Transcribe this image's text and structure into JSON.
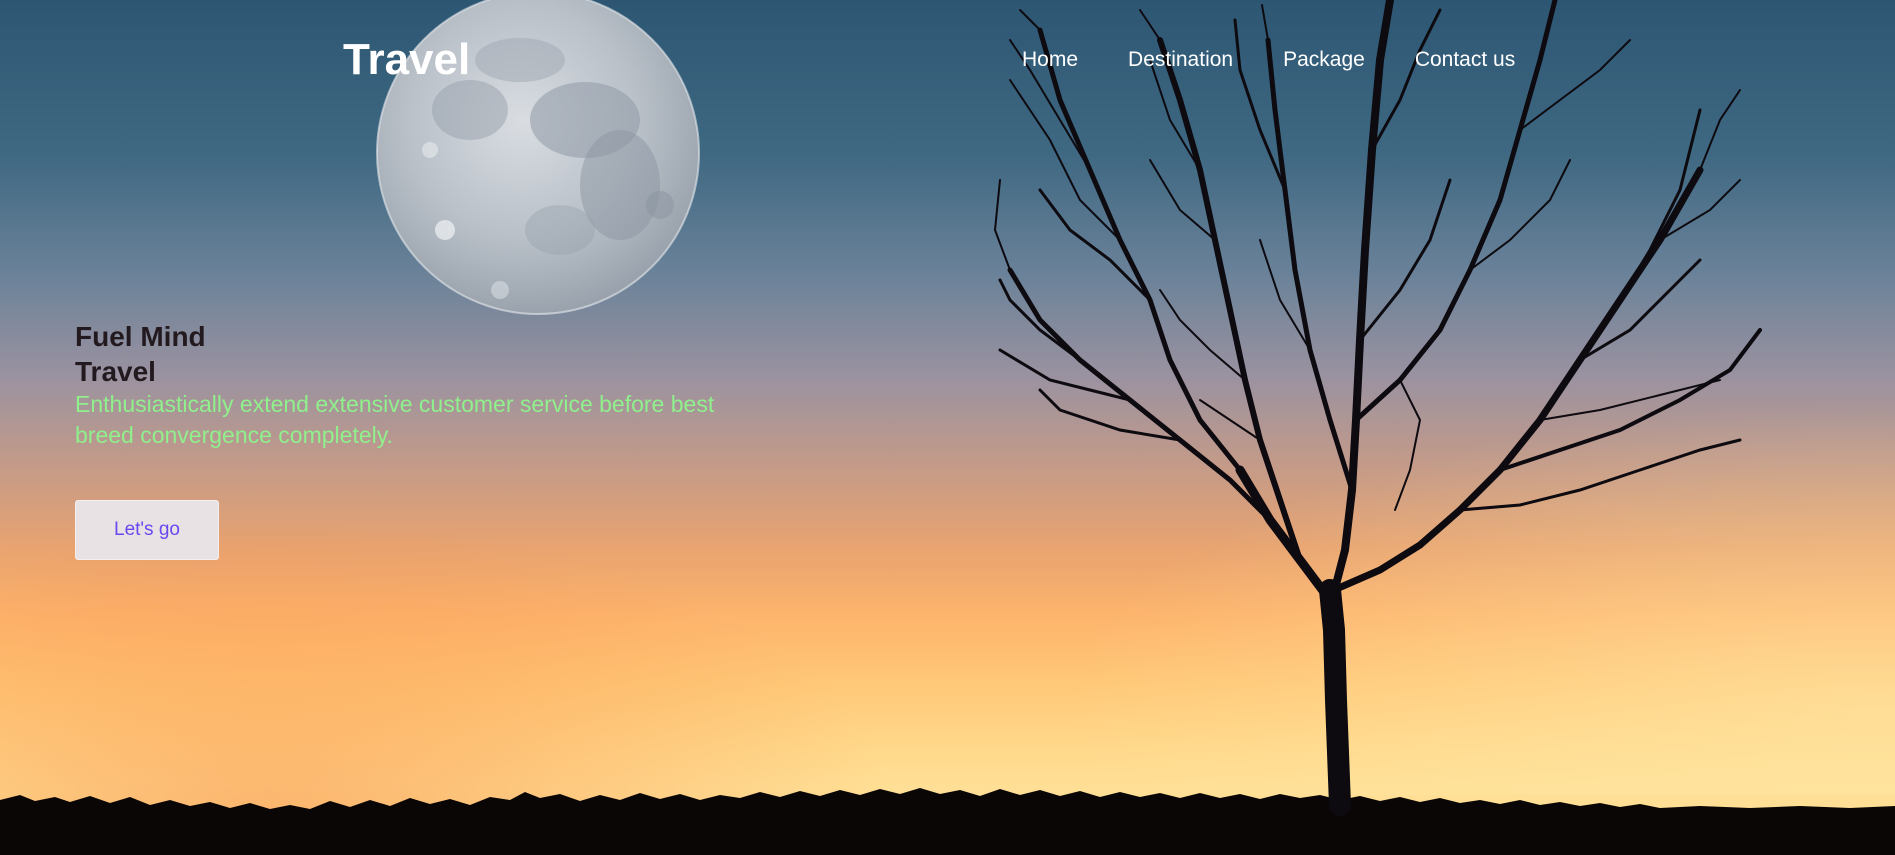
{
  "brand": {
    "logo_text": "Travel"
  },
  "nav": {
    "items": [
      {
        "label": "Home"
      },
      {
        "label": "Destination"
      },
      {
        "label": "Package"
      },
      {
        "label": "Contact us"
      }
    ]
  },
  "hero": {
    "title": "Fuel Mind Travel",
    "description": "Enthusiastically extend extensive customer service before best breed convergence completely.",
    "cta_label": "Let's go"
  },
  "colors": {
    "sky_top": "#2d5673",
    "sky_bottom": "#ffdf95",
    "title_color": "#231a1f",
    "description_color": "#8ff08c",
    "cta_text": "#6a47f0",
    "cta_bg": "#e9e2e4"
  },
  "icons": {
    "background": "moon-tree-sunset-image"
  }
}
